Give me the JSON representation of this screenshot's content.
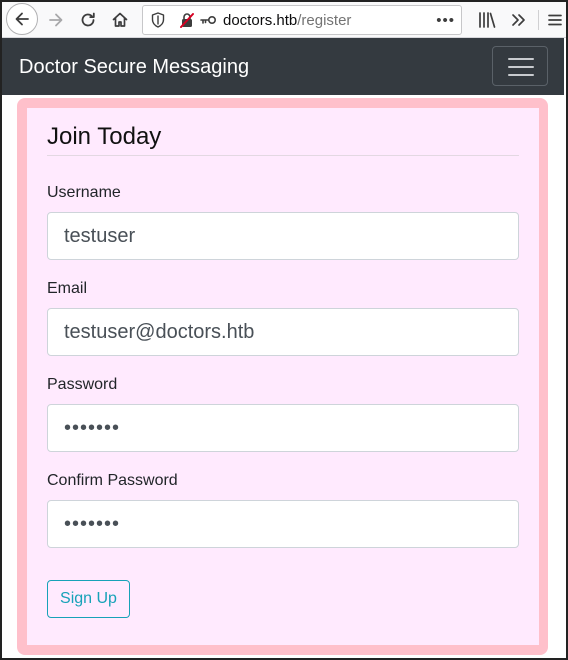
{
  "browser": {
    "url_host": "doctors.htb",
    "url_path": "/register",
    "page_actions": "•••"
  },
  "navbar": {
    "brand": "Doctor Secure Messaging"
  },
  "form": {
    "legend": "Join Today",
    "username": {
      "label": "Username",
      "value": "testuser"
    },
    "email": {
      "label": "Email",
      "value": "testuser@doctors.htb"
    },
    "password": {
      "label": "Password",
      "value": "•••••••"
    },
    "confirm_password": {
      "label": "Confirm Password",
      "value": "•••••••"
    },
    "submit_label": "Sign Up"
  },
  "colors": {
    "card_border": "#ffc0cb",
    "card_background": "#ffeafe",
    "navbar": "#343a40",
    "button_outline": "#17a2b8"
  }
}
